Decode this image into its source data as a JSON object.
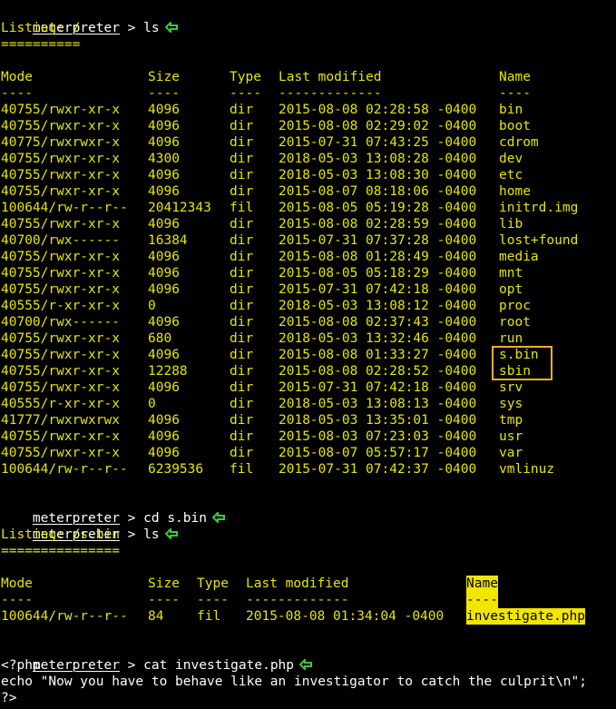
{
  "prompt": "meterpreter",
  "session1": {
    "command": " > ls",
    "listing": "Listing: /",
    "rule": "==========",
    "headers": {
      "mode": "Mode",
      "size": "Size",
      "type": "Type",
      "modified": "Last modified",
      "name": "Name"
    },
    "dashes": {
      "mode": "----",
      "size": "----",
      "type": "----",
      "modified": "-------------",
      "name": "----"
    },
    "rows": [
      [
        "40755/rwxr-xr-x",
        "4096",
        "dir",
        "2015-08-08 02:28:58 -0400",
        "bin"
      ],
      [
        "40755/rwxr-xr-x",
        "4096",
        "dir",
        "2015-08-08 02:29:02 -0400",
        "boot"
      ],
      [
        "40775/rwxrwxr-x",
        "4096",
        "dir",
        "2015-07-31 07:43:25 -0400",
        "cdrom"
      ],
      [
        "40755/rwxr-xr-x",
        "4300",
        "dir",
        "2018-05-03 13:08:28 -0400",
        "dev"
      ],
      [
        "40755/rwxr-xr-x",
        "4096",
        "dir",
        "2018-05-03 13:08:30 -0400",
        "etc"
      ],
      [
        "40755/rwxr-xr-x",
        "4096",
        "dir",
        "2015-08-07 08:18:06 -0400",
        "home"
      ],
      [
        "100644/rw-r--r--",
        "20412343",
        "fil",
        "2015-08-05 05:19:28 -0400",
        "initrd.img"
      ],
      [
        "40755/rwxr-xr-x",
        "4096",
        "dir",
        "2015-08-08 02:28:59 -0400",
        "lib"
      ],
      [
        "40700/rwx------",
        "16384",
        "dir",
        "2015-07-31 07:37:28 -0400",
        "lost+found"
      ],
      [
        "40755/rwxr-xr-x",
        "4096",
        "dir",
        "2015-08-08 01:28:49 -0400",
        "media"
      ],
      [
        "40755/rwxr-xr-x",
        "4096",
        "dir",
        "2015-08-05 05:18:29 -0400",
        "mnt"
      ],
      [
        "40755/rwxr-xr-x",
        "4096",
        "dir",
        "2015-07-31 07:42:18 -0400",
        "opt"
      ],
      [
        "40555/r-xr-xr-x",
        "0",
        "dir",
        "2018-05-03 13:08:12 -0400",
        "proc"
      ],
      [
        "40700/rwx------",
        "4096",
        "dir",
        "2015-08-08 02:37:43 -0400",
        "root"
      ],
      [
        "40755/rwxr-xr-x",
        "680",
        "dir",
        "2018-05-03 13:32:46 -0400",
        "run"
      ],
      [
        "40755/rwxr-xr-x",
        "4096",
        "dir",
        "2015-08-08 01:33:27 -0400",
        "s.bin"
      ],
      [
        "40755/rwxr-xr-x",
        "12288",
        "dir",
        "2015-08-08 02:28:52 -0400",
        "sbin"
      ],
      [
        "40755/rwxr-xr-x",
        "4096",
        "dir",
        "2015-07-31 07:42:18 -0400",
        "srv"
      ],
      [
        "40555/r-xr-xr-x",
        "0",
        "dir",
        "2018-05-03 13:08:13 -0400",
        "sys"
      ],
      [
        "41777/rwxrwxrwx",
        "4096",
        "dir",
        "2018-05-03 13:35:01 -0400",
        "tmp"
      ],
      [
        "40755/rwxr-xr-x",
        "4096",
        "dir",
        "2015-08-03 07:23:03 -0400",
        "usr"
      ],
      [
        "40755/rwxr-xr-x",
        "4096",
        "dir",
        "2015-08-07 05:57:17 -0400",
        "var"
      ],
      [
        "100644/rw-r--r--",
        "6239536",
        "fil",
        "2015-07-31 07:42:37 -0400",
        "vmlinuz"
      ]
    ]
  },
  "session2": {
    "cd_command": " > cd s.bin",
    "ls_command": " > ls",
    "listing": "Listing: /s.bin",
    "rule": "===============",
    "headers": {
      "mode": "Mode",
      "size": "Size",
      "type": "Type",
      "modified": "Last modified",
      "name": "Name"
    },
    "dashes": {
      "mode": "----",
      "size": "----",
      "type": "----",
      "modified": "-------------",
      "name": "----"
    },
    "row": [
      "100644/rw-r--r--",
      "84",
      "fil",
      "2015-08-08 01:34:04 -0400",
      "investigate.php"
    ]
  },
  "session3": {
    "command": " > cat investigate.php",
    "output": [
      "<?php",
      "echo \"Now you have to behave like an investigator to catch the culprit\\n\";",
      "?>"
    ]
  },
  "colors": {
    "text": "#e6e600",
    "highlight_box": "#f0b020",
    "arrow": "#3cc83c",
    "highlight_bg": "#f2e600"
  }
}
